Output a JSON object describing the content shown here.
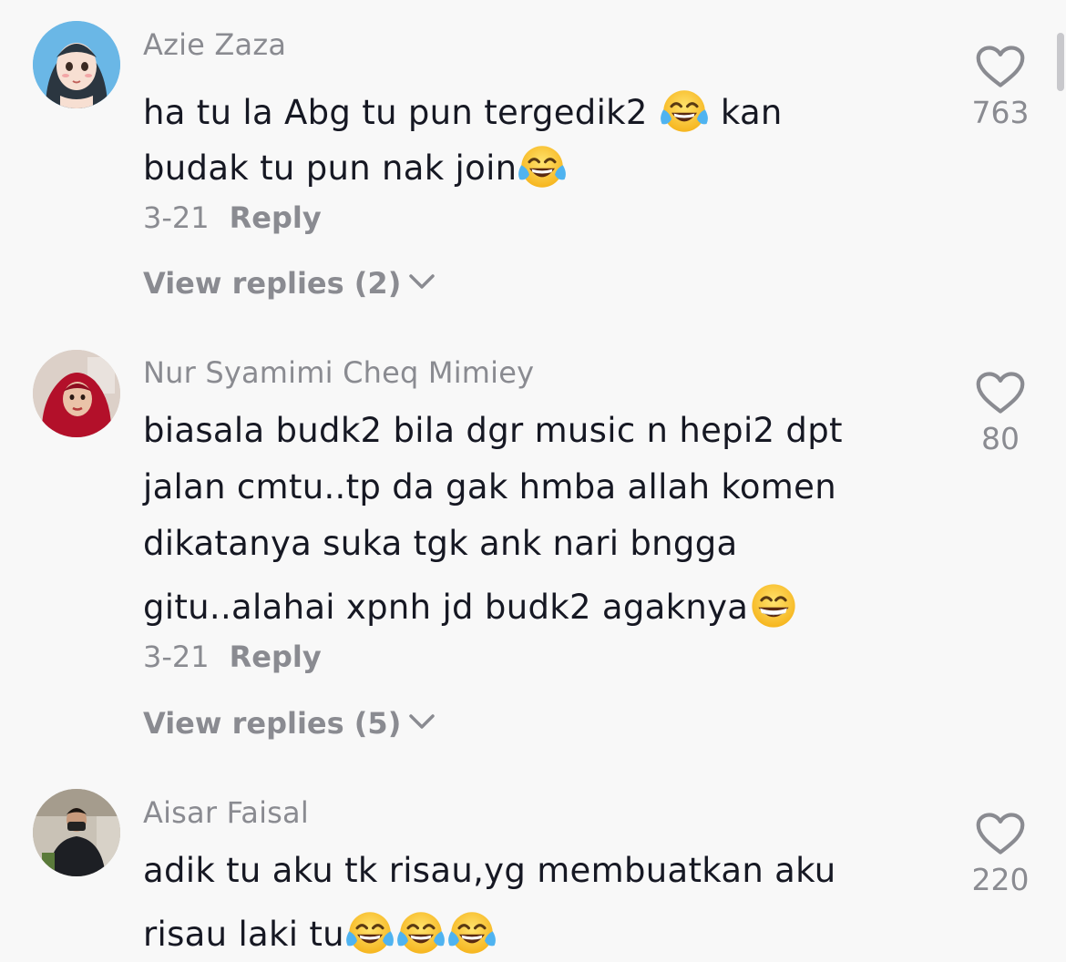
{
  "comments": [
    {
      "username": "Azie Zaza",
      "lines": [
        "ha tu la Abg tu pun tergedik2 ",
        " kan",
        "budak tu pun nak join"
      ],
      "date": "3-21",
      "reply_label": "Reply",
      "view_replies": "View replies (2)",
      "likes": "763",
      "avatar": "avatar-illustrated-hijab",
      "emoji": "face-with-tears-of-joy"
    },
    {
      "username": "Nur Syamimi Cheq Mimiey",
      "lines": [
        "biasala budk2 bila dgr music n hepi2 dpt",
        "jalan cmtu..tp da gak hmba allah komen",
        "dikatanya suka tgk ank nari bngga",
        "gitu..alahai xpnh jd budk2 agaknya"
      ],
      "date": "3-21",
      "reply_label": "Reply",
      "view_replies": "View replies (5)",
      "likes": "80",
      "avatar": "avatar-photo-red-hijab",
      "emoji": "grinning-face-with-smiling-eyes"
    },
    {
      "username": "Aisar Faisal",
      "lines": [
        "adik tu aku tk risau,yg membuatkan aku",
        "risau laki tu"
      ],
      "likes": "220",
      "avatar": "avatar-photo-man",
      "emoji": "face-with-tears-of-joy"
    }
  ],
  "colors": {
    "background": "#f8f8f8",
    "text_primary": "#161823",
    "text_secondary": "#8a8b91"
  },
  "icons": [
    "heart-outline-icon",
    "chevron-down-icon"
  ]
}
